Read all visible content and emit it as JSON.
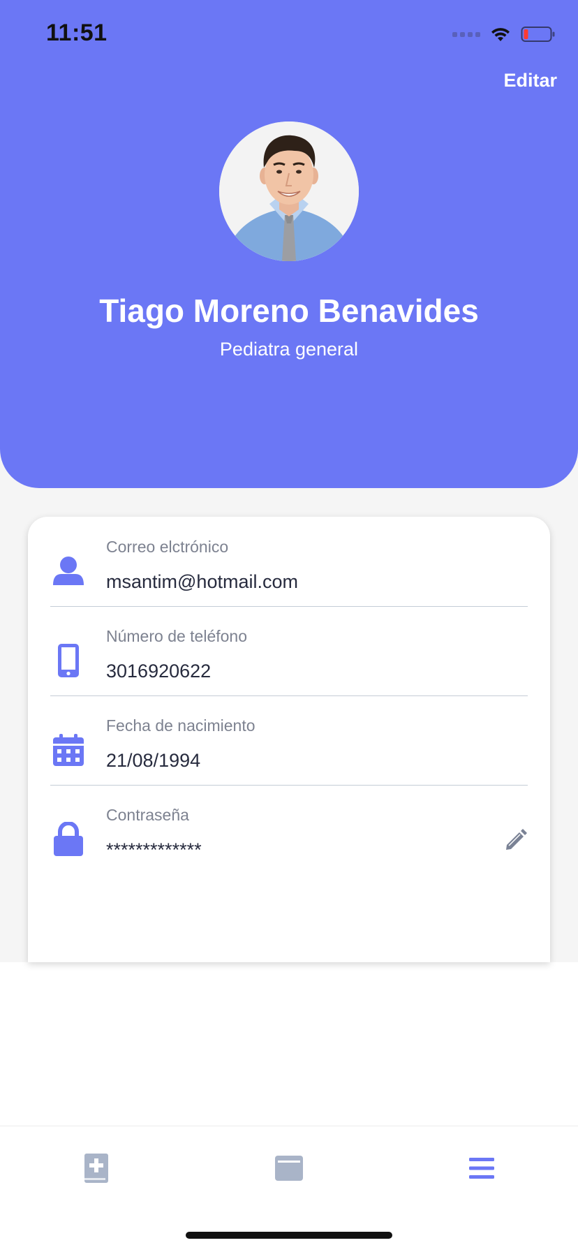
{
  "status_bar": {
    "time": "11:51"
  },
  "header": {
    "edit_label": "Editar",
    "name": "Tiago Moreno Benavides",
    "role": "Pediatra general",
    "background": "#6b77f5"
  },
  "fields": [
    {
      "icon": "user-icon",
      "label": "Correo elctrónico",
      "value": "msantim@hotmail.com"
    },
    {
      "icon": "phone-icon",
      "label": "Número de teléfono",
      "value": "3016920622"
    },
    {
      "icon": "calendar-icon",
      "label": "Fecha de nacimiento",
      "value": "21/08/1994"
    },
    {
      "icon": "lock-icon",
      "label": "Contraseña",
      "value": "*************",
      "action_icon": "pencil-icon"
    }
  ],
  "tabbar": {
    "tabs": [
      {
        "icon": "medical-book-icon",
        "active": false
      },
      {
        "icon": "card-icon",
        "active": false
      },
      {
        "icon": "menu-icon",
        "active": true
      }
    ],
    "active_color": "#6b77f5",
    "inactive_color": "#a9b4c8"
  }
}
